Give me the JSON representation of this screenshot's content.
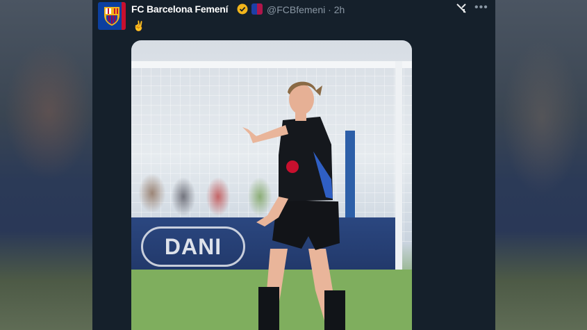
{
  "tweet": {
    "account_name": "FC Barcelona Femení",
    "handle": "@FCBfemeni",
    "separator": "·",
    "time": "2h",
    "text": "✌"
  },
  "icons": {
    "avatar": "fcb-crest-avatar",
    "verified": "verified-badge-icon",
    "affiliate": "fcb-affiliate-badge-icon",
    "app_logo": "grok-x-icon",
    "more": "more-options-icon"
  },
  "media": {
    "banner_text": "DANI"
  },
  "colors": {
    "card_background": "#15202b",
    "name_text": "#ffffff",
    "handle_text": "#8b98a5",
    "verified": "#f2b51b",
    "club_blue": "#0b3fa0",
    "club_red": "#c8102e"
  }
}
